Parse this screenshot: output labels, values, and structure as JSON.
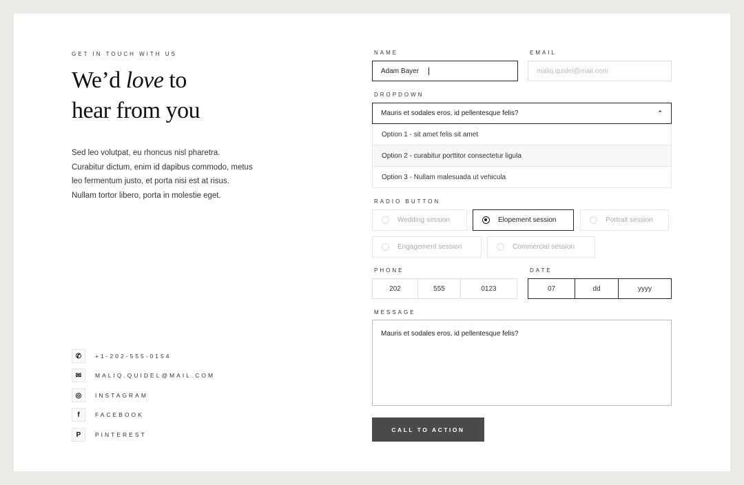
{
  "left": {
    "eyebrow": "GET IN TOUCH WITH US",
    "heading_a": "We’d ",
    "heading_em": "love",
    "heading_b": " to",
    "heading_line2": "hear from you",
    "paragraph": "Sed leo volutpat, eu rhoncus nisl pharetra. Curabitur dictum, enim id dapibus commodo, metus leo fermentum justo, et porta nisi est at risus. Nullam tortor libero, porta in molestie eget.",
    "contacts": [
      {
        "icon": "phone-icon",
        "glyph": "✆",
        "label": "+1-202-555-0154"
      },
      {
        "icon": "mail-icon",
        "glyph": "✉",
        "label": "MALIQ.QUIDEL@MAIL.COM"
      },
      {
        "icon": "instagram-icon",
        "glyph": "◎",
        "label": "INSTAGRAM"
      },
      {
        "icon": "facebook-icon",
        "glyph": "f",
        "label": "FACEBOOK"
      },
      {
        "icon": "pinterest-icon",
        "glyph": "P",
        "label": "PINTEREST"
      }
    ]
  },
  "form": {
    "name_label": "NAME",
    "name_value": "Adam Bayer",
    "email_label": "EMAIL",
    "email_placeholder": "maliq.quidel@mail.com",
    "dropdown_label": "DROPDOWN",
    "dropdown_value": "Mauris et sodales eros, id pellentesque felis?",
    "options": [
      "Option 1 - sit amet felis sit amet",
      "Option 2 - curabitur porttitor consectetur ligula",
      "Option 3 - Nullam malesuada ut vehicula"
    ],
    "radio_label": "RADIO BUTTON",
    "radios": [
      "Wedding session",
      "Elopement session",
      "Portrait session",
      "Engagement session",
      "Commercial session"
    ],
    "radio_selected": "Elopement session",
    "phone_label": "PHONE",
    "phone": [
      "202",
      "555",
      "0123"
    ],
    "date_label": "DATE",
    "date": [
      "07",
      "dd",
      "yyyy"
    ],
    "message_label": "MESSAGE",
    "message_value": "Mauris et sodales eros, id pellentesque felis?",
    "cta": "CALL TO ACTION"
  }
}
